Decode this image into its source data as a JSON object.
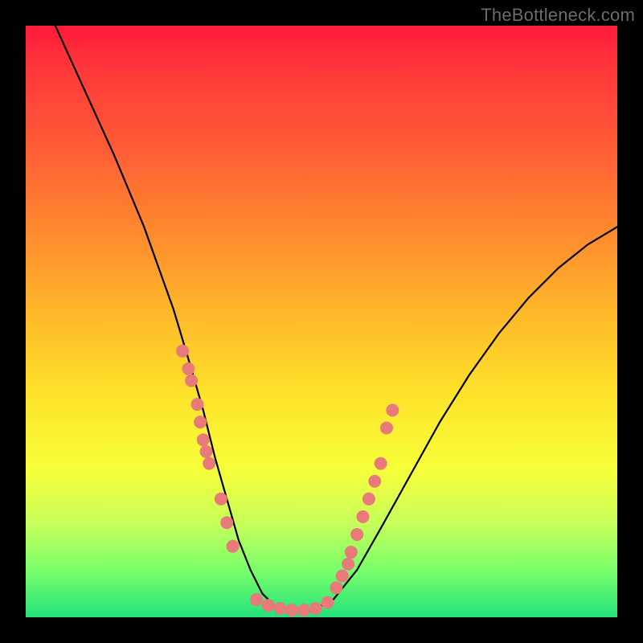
{
  "watermark": {
    "text": "TheBottleneck.com"
  },
  "chart_data": {
    "type": "line",
    "title": "",
    "xlabel": "",
    "ylabel": "",
    "xlim": [
      0,
      100
    ],
    "ylim": [
      0,
      100
    ],
    "series": [
      {
        "name": "curve",
        "x": [
          5,
          10,
          15,
          20,
          25,
          28,
          30,
          32,
          34,
          36,
          38,
          40,
          42,
          45,
          48,
          52,
          56,
          60,
          65,
          70,
          75,
          80,
          85,
          90,
          95,
          100
        ],
        "y": [
          100,
          89,
          78,
          66,
          52,
          42,
          35,
          27,
          20,
          13,
          8,
          4,
          2,
          1,
          1,
          3,
          8,
          15,
          24,
          33,
          41,
          48,
          54,
          59,
          63,
          66
        ]
      }
    ],
    "markers": [
      {
        "cluster": "left",
        "points": [
          {
            "x": 26.5,
            "y": 45
          },
          {
            "x": 27.5,
            "y": 42
          },
          {
            "x": 28.0,
            "y": 40
          },
          {
            "x": 29.0,
            "y": 36
          },
          {
            "x": 29.5,
            "y": 33
          },
          {
            "x": 30.0,
            "y": 30
          },
          {
            "x": 30.5,
            "y": 28
          },
          {
            "x": 31.0,
            "y": 26
          },
          {
            "x": 33.0,
            "y": 20
          },
          {
            "x": 34.0,
            "y": 16
          },
          {
            "x": 35.0,
            "y": 12
          }
        ]
      },
      {
        "cluster": "bottom",
        "points": [
          {
            "x": 39.0,
            "y": 3
          },
          {
            "x": 41.0,
            "y": 2
          },
          {
            "x": 43.0,
            "y": 1.5
          },
          {
            "x": 45.0,
            "y": 1.2
          },
          {
            "x": 47.0,
            "y": 1.2
          },
          {
            "x": 49.0,
            "y": 1.5
          },
          {
            "x": 51.0,
            "y": 2.5
          }
        ]
      },
      {
        "cluster": "right",
        "points": [
          {
            "x": 52.5,
            "y": 5
          },
          {
            "x": 53.5,
            "y": 7
          },
          {
            "x": 54.5,
            "y": 9
          },
          {
            "x": 55.0,
            "y": 11
          },
          {
            "x": 56.0,
            "y": 14
          },
          {
            "x": 57.0,
            "y": 17
          },
          {
            "x": 58.0,
            "y": 20
          },
          {
            "x": 59.0,
            "y": 23
          },
          {
            "x": 60.0,
            "y": 26
          },
          {
            "x": 61.0,
            "y": 32
          },
          {
            "x": 62.0,
            "y": 35
          }
        ]
      }
    ],
    "colors": {
      "curve": "#000000",
      "marker_fill": "#e87a7a",
      "marker_stroke": "#d85a5a"
    }
  }
}
